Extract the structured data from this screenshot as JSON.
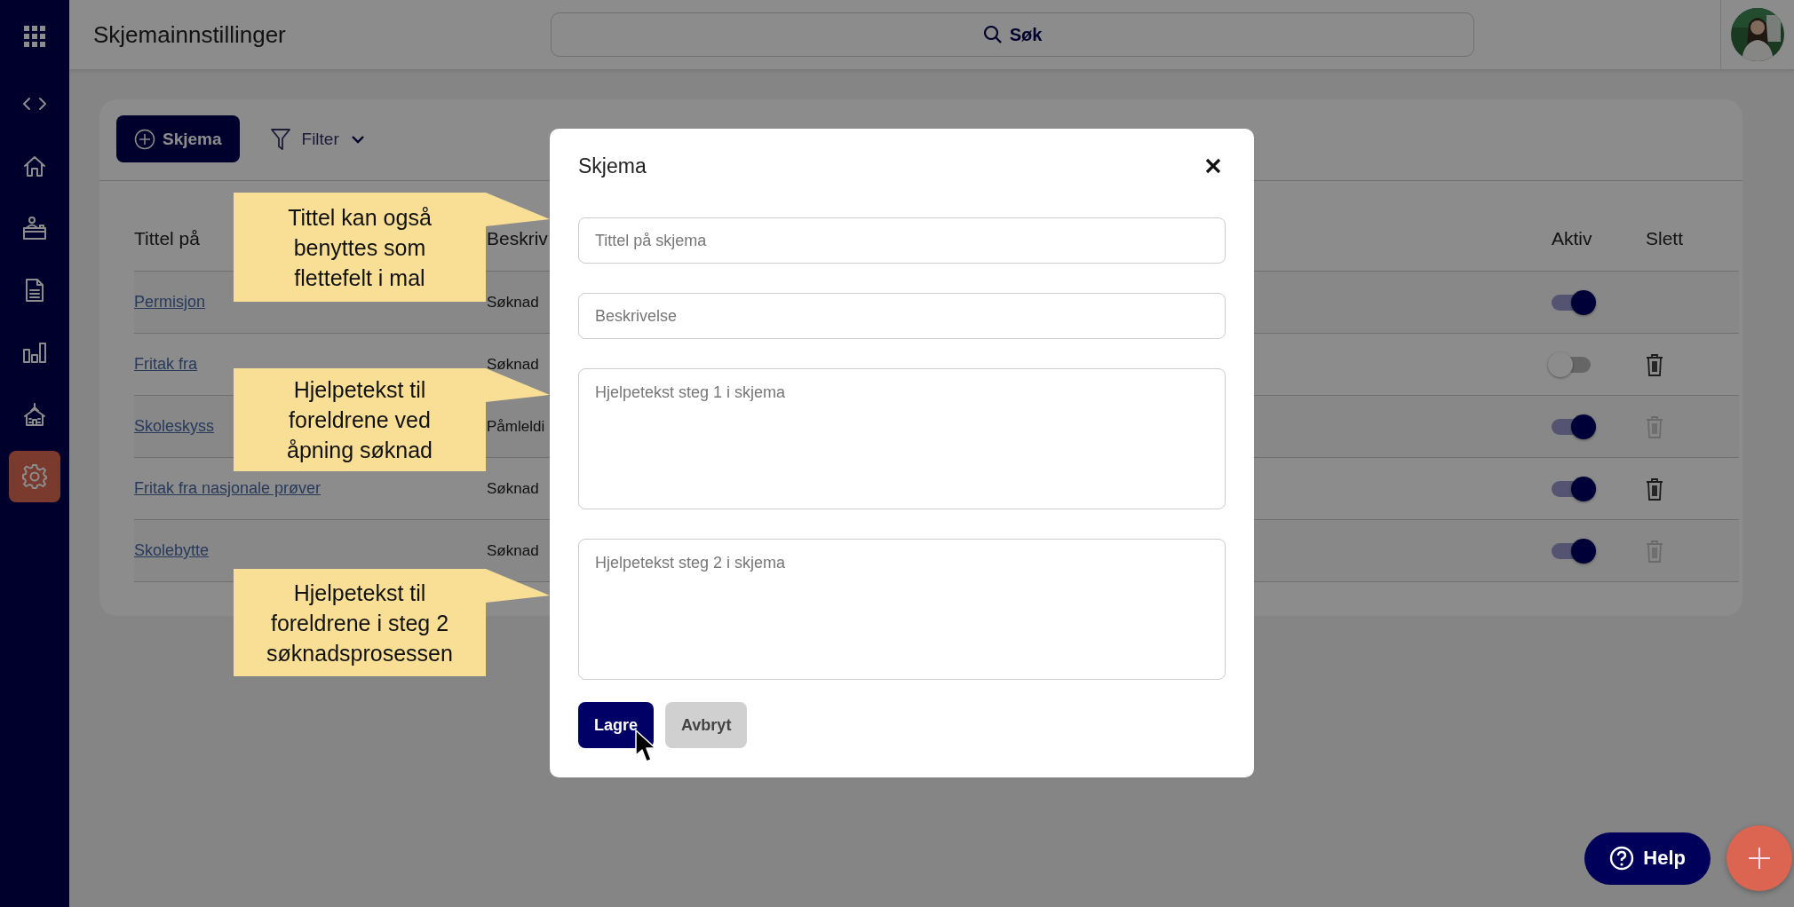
{
  "sidebar": {
    "items": [
      {
        "selected": false
      },
      {
        "selected": false
      },
      {
        "selected": false
      },
      {
        "selected": false
      },
      {
        "selected": false
      },
      {
        "selected": true
      }
    ]
  },
  "header": {
    "title": "Skjemainnstillinger",
    "search": {
      "label": "Søk"
    }
  },
  "toolbar": {
    "new_button": "Skjema",
    "filter": "Filter"
  },
  "table": {
    "columns": [
      "Tittel på",
      "Beskriv",
      "Aktiv",
      "Slett"
    ],
    "rows": [
      {
        "title": "Permisjon",
        "description": "Søknad",
        "active": true
      },
      {
        "title": "Fritak fra",
        "description": "Søknad",
        "active": false,
        "delete_button": {
          "disabled": false
        }
      },
      {
        "title": "Skoleskyss",
        "description": "Påmleldi",
        "active": true,
        "delete_button": {
          "disabled": true
        }
      },
      {
        "title": "Fritak fra nasjonale prøver",
        "description": "Søknad",
        "active": true,
        "delete_button": {
          "disabled": false
        }
      },
      {
        "title": "Skolebytte",
        "description": "Søknad",
        "active": true,
        "delete_button": {
          "disabled": true
        }
      }
    ]
  },
  "modal": {
    "title": "Skjema",
    "fields": [
      {
        "kind": "input",
        "placeholder": "Tittel på skjema"
      },
      {
        "kind": "input",
        "placeholder": "Beskrivelse"
      },
      {
        "kind": "textarea",
        "placeholder": "Hjelpetekst steg 1 i skjema"
      },
      {
        "kind": "textarea",
        "placeholder": "Hjelpetekst steg 2 i skjema"
      }
    ],
    "buttons": [
      {
        "kind": "primary",
        "label": "Lagre"
      },
      {
        "kind": "secondary",
        "label": "Avbryt"
      }
    ]
  },
  "callouts": [
    "Tittel kan også benyttes som flettefelt i mal",
    "Hjelpetekst til foreldrene ved åpning søknad",
    "Hjelpetekst til foreldrene i steg 2 søknadsprosessen"
  ],
  "help_button": "Help"
}
